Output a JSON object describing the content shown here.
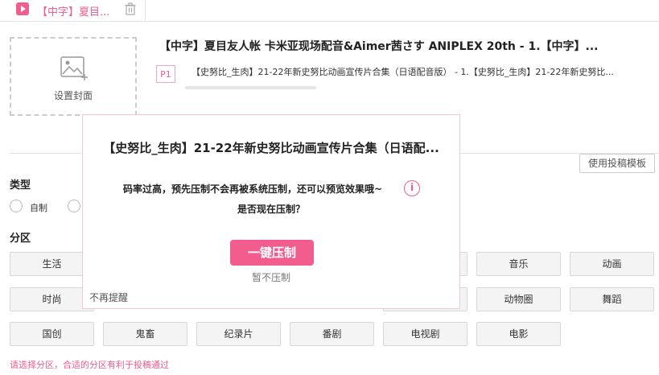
{
  "tab": {
    "title": "【中字】夏目..."
  },
  "cover": {
    "label": "设置封面"
  },
  "video": {
    "title": "【中字】夏目友人帐 卡米亚现场配音&Aimer茜さす ANIPLEX 20th - 1.【中字】...",
    "part_badge": "P1",
    "part_title": "【史努比_生肉】21-22年新史努比动画宣传片合集（日语配音版） - 1.【史努比_生肉】21-22年新史努比..."
  },
  "template_button": "使用投稿模板",
  "type_section": {
    "label": "类型",
    "options": [
      "自制"
    ]
  },
  "category_section": {
    "label": "分区",
    "rows": [
      [
        "生活",
        "",
        "",
        "",
        "",
        "音乐",
        "动画"
      ],
      [
        "时尚",
        "",
        "",
        "",
        "",
        "动物圈",
        "舞蹈"
      ],
      [
        "国创",
        "鬼畜",
        "纪录片",
        "番剧",
        "电视剧",
        "电影"
      ]
    ]
  },
  "hint": "请选择分区，合适的分区有利于投稿通过",
  "modal": {
    "title": "【史努比_生肉】21-22年新史努比动画宣传片合集（日语配...",
    "message_line1": "码率过高，预先压制不会再被系统压制，还可以预览效果哦~",
    "info_glyph": "i",
    "message_line2": "是否现在压制？",
    "primary_button": "一键压制",
    "secondary_link": "暂不压制",
    "no_remind": "不再提醒"
  },
  "colors": {
    "accent": "#f25d8e"
  }
}
